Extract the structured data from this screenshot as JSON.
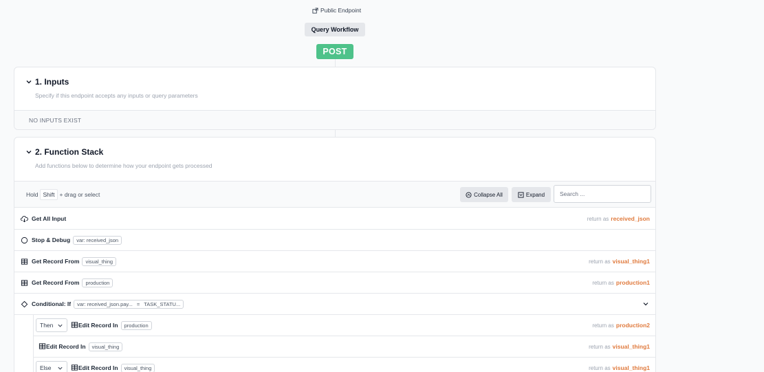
{
  "endpoint": {
    "visibility_label": "Public Endpoint",
    "workflow_name": "Query Workflow",
    "method": "POST"
  },
  "inputs_section": {
    "title": "1. Inputs",
    "subtitle": "Specify if this endpoint accepts any inputs or query parameters",
    "empty_text": "NO INPUTS EXIST"
  },
  "function_stack": {
    "title": "2. Function Stack",
    "subtitle": "Add functions below to determine how your endpoint gets processed",
    "hold_label": "Hold",
    "hold_key": "Shift",
    "hold_suffix": "+ drag or select",
    "collapse_all_label": "Collapse All",
    "expand_label": "Expand",
    "search_placeholder": "Search ...",
    "return_prefix": "return as",
    "rows": [
      {
        "name": "Get All Input",
        "icon": "cloud-download-icon",
        "tag": "",
        "return_var": "received_json"
      },
      {
        "name": "Stop & Debug",
        "icon": "stop-circle-icon",
        "tag": "var: received_json",
        "return_var": ""
      },
      {
        "name": "Get Record From",
        "icon": "table-icon",
        "tag": "visual_thing",
        "return_var": "visual_thing1"
      },
      {
        "name": "Get Record From",
        "icon": "table-icon",
        "tag": "production",
        "return_var": "production1"
      },
      {
        "name": "Conditional: If",
        "icon": "diamond-icon",
        "tag": "var: received_json.pay...",
        "tag_op": "=",
        "tag_value": "TASK_STATU...",
        "return_var": ""
      }
    ],
    "nested_rows": [
      {
        "branch": "Then",
        "name": "Edit Record In",
        "icon": "table-icon",
        "tag": "production",
        "return_var": "production2"
      },
      {
        "branch": "",
        "name": "Edit Record In",
        "icon": "table-icon",
        "tag": "visual_thing",
        "return_var": "visual_thing1"
      },
      {
        "branch": "Else",
        "name": "Edit Record In",
        "icon": "table-icon",
        "tag": "visual_thing",
        "return_var": "visual_thing1"
      }
    ]
  },
  "colors": {
    "method_green": "#4ec28a",
    "return_var_orange": "#e07a3d"
  }
}
